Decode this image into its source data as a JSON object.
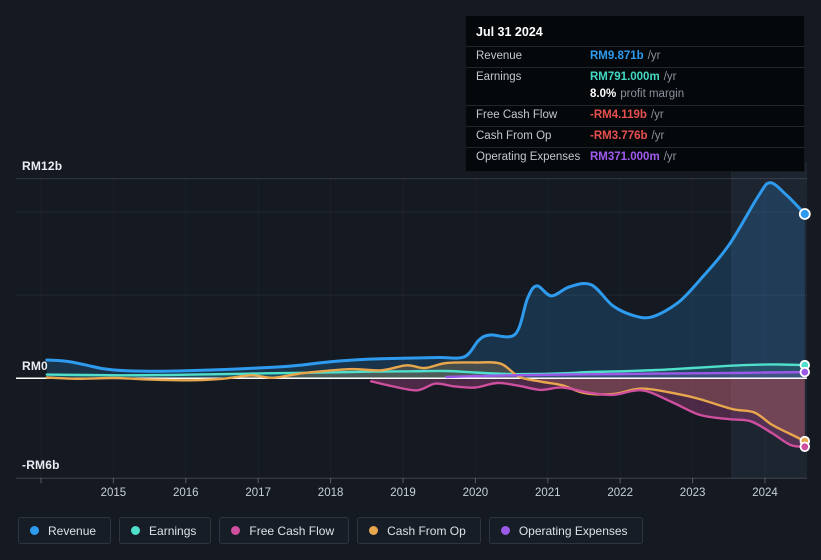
{
  "tooltip": {
    "title": "Jul 31 2024",
    "rows": [
      {
        "key": "revenue",
        "label": "Revenue",
        "value": "RM9.871b",
        "suffix": "/yr",
        "color": "#2E9BEF"
      },
      {
        "key": "earnings",
        "label": "Earnings",
        "value": "RM791.000m",
        "suffix": "/yr",
        "color": "#43D9C4"
      },
      {
        "key": "profit-margin",
        "type": "margin",
        "bold": "8.0%",
        "rest": "profit margin"
      },
      {
        "key": "free-cash-flow",
        "label": "Free Cash Flow",
        "value": "-RM4.119b",
        "suffix": "/yr",
        "color": "#E8504F"
      },
      {
        "key": "cash-from-op",
        "label": "Cash From Op",
        "value": "-RM3.776b",
        "suffix": "/yr",
        "color": "#E8504F"
      },
      {
        "key": "operating-expenses",
        "label": "Operating Expenses",
        "value": "RM371.000m",
        "suffix": "/yr",
        "color": "#A15BF0"
      }
    ]
  },
  "legend": {
    "items": [
      {
        "key": "revenue",
        "label": "Revenue",
        "color": "#2E9BEF"
      },
      {
        "key": "earnings",
        "label": "Earnings",
        "color": "#4FDFCB"
      },
      {
        "key": "free-cash-flow",
        "label": "Free Cash Flow",
        "color": "#CD4F9E"
      },
      {
        "key": "cash-from-op",
        "label": "Cash From Op",
        "color": "#E8A64D"
      },
      {
        "key": "operating-expenses",
        "label": "Operating Expenses",
        "color": "#9B59E8"
      }
    ]
  },
  "colors": {
    "background": "#151A22",
    "zero_line": "#FFFFFF",
    "axis_text": "#C9CFD6",
    "tooltip_background": "#05080B"
  },
  "chart_data": {
    "type": "line",
    "currency": "RM",
    "unit": "billions_per_year",
    "title": "",
    "xlabel": "",
    "ylabel": "RM",
    "ylim": [
      -6,
      12
    ],
    "xlim": [
      2013.65,
      2024.58
    ],
    "grid": true,
    "legend_position": "bottom",
    "ylabels": {
      "top": "RM12b",
      "zero": "RM0",
      "bottom": "-RM6b"
    },
    "gridlines_b": [
      12,
      10,
      5
    ],
    "x_ticks": [
      {
        "year": 2014,
        "label": ""
      },
      {
        "year": 2015,
        "label": "2015"
      },
      {
        "year": 2016,
        "label": "2016"
      },
      {
        "year": 2017,
        "label": "2017"
      },
      {
        "year": 2018,
        "label": "2018"
      },
      {
        "year": 2019,
        "label": "2019"
      },
      {
        "year": 2020,
        "label": "2020"
      },
      {
        "year": 2021,
        "label": "2021"
      },
      {
        "year": 2022,
        "label": "2022"
      },
      {
        "year": 2023,
        "label": "2023"
      },
      {
        "year": 2024,
        "label": "2024"
      }
    ],
    "highlight_band": {
      "from": 2023.54,
      "to": 2024.58
    },
    "series": [
      {
        "key": "revenue",
        "name": "Revenue",
        "color": "#2E9BEF",
        "fill": "rgba(46,155,239,0.20)",
        "end_value_label": "RM9.871b",
        "points": [
          [
            2014.08,
            1.1
          ],
          [
            2014.35,
            1.02
          ],
          [
            2014.6,
            0.82
          ],
          [
            2014.85,
            0.58
          ],
          [
            2015.15,
            0.46
          ],
          [
            2015.6,
            0.42
          ],
          [
            2016.0,
            0.45
          ],
          [
            2016.5,
            0.52
          ],
          [
            2017.0,
            0.62
          ],
          [
            2017.5,
            0.75
          ],
          [
            2018.0,
            1.0
          ],
          [
            2018.5,
            1.15
          ],
          [
            2019.0,
            1.2
          ],
          [
            2019.5,
            1.25
          ],
          [
            2019.85,
            1.3
          ],
          [
            2020.05,
            2.3
          ],
          [
            2020.2,
            2.6
          ],
          [
            2020.55,
            2.65
          ],
          [
            2020.72,
            4.8
          ],
          [
            2020.85,
            5.55
          ],
          [
            2021.05,
            4.95
          ],
          [
            2021.3,
            5.5
          ],
          [
            2021.6,
            5.62
          ],
          [
            2021.9,
            4.35
          ],
          [
            2022.2,
            3.75
          ],
          [
            2022.45,
            3.7
          ],
          [
            2022.8,
            4.55
          ],
          [
            2023.1,
            5.9
          ],
          [
            2023.5,
            8.0
          ],
          [
            2023.9,
            10.9
          ],
          [
            2024.07,
            11.75
          ],
          [
            2024.3,
            11.0
          ],
          [
            2024.55,
            9.871
          ]
        ]
      },
      {
        "key": "earnings",
        "name": "Earnings",
        "color": "#4FDFCB",
        "fill": "rgba(79,223,203,0.14)",
        "end_value_label": "RM791.000m",
        "points": [
          [
            2014.08,
            0.22
          ],
          [
            2014.6,
            0.2
          ],
          [
            2015.1,
            0.18
          ],
          [
            2015.6,
            0.19
          ],
          [
            2016.1,
            0.22
          ],
          [
            2016.6,
            0.26
          ],
          [
            2017.1,
            0.3
          ],
          [
            2017.6,
            0.33
          ],
          [
            2018.1,
            0.36
          ],
          [
            2018.6,
            0.4
          ],
          [
            2019.1,
            0.42
          ],
          [
            2019.6,
            0.44
          ],
          [
            2020.0,
            0.35
          ],
          [
            2020.4,
            0.27
          ],
          [
            2020.8,
            0.26
          ],
          [
            2021.2,
            0.3
          ],
          [
            2021.6,
            0.38
          ],
          [
            2022.0,
            0.42
          ],
          [
            2022.5,
            0.5
          ],
          [
            2023.0,
            0.62
          ],
          [
            2023.5,
            0.75
          ],
          [
            2023.9,
            0.82
          ],
          [
            2024.2,
            0.83
          ],
          [
            2024.55,
            0.791
          ]
        ]
      },
      {
        "key": "cash-from-op",
        "name": "Cash From Op",
        "color": "#E8A64D",
        "fill": "rgba(232,166,77,0.22)",
        "end_value_label": "-RM3.776b",
        "points": [
          [
            2014.08,
            0.05
          ],
          [
            2014.5,
            -0.03
          ],
          [
            2015.0,
            0.02
          ],
          [
            2015.5,
            -0.08
          ],
          [
            2016.05,
            -0.12
          ],
          [
            2016.5,
            -0.03
          ],
          [
            2016.9,
            0.18
          ],
          [
            2017.2,
            0.03
          ],
          [
            2017.6,
            0.3
          ],
          [
            2017.95,
            0.45
          ],
          [
            2018.3,
            0.55
          ],
          [
            2018.7,
            0.48
          ],
          [
            2019.05,
            0.78
          ],
          [
            2019.3,
            0.62
          ],
          [
            2019.6,
            0.92
          ],
          [
            2020.0,
            0.95
          ],
          [
            2020.35,
            0.88
          ],
          [
            2020.6,
            0.1
          ],
          [
            2020.9,
            -0.2
          ],
          [
            2021.2,
            -0.42
          ],
          [
            2021.5,
            -0.88
          ],
          [
            2021.9,
            -0.95
          ],
          [
            2022.3,
            -0.62
          ],
          [
            2022.8,
            -0.95
          ],
          [
            2023.1,
            -1.25
          ],
          [
            2023.55,
            -1.85
          ],
          [
            2023.85,
            -2.05
          ],
          [
            2024.1,
            -2.8
          ],
          [
            2024.35,
            -3.35
          ],
          [
            2024.55,
            -3.776
          ]
        ]
      },
      {
        "key": "free-cash-flow",
        "name": "Free Cash Flow",
        "color": "#CD4F9E",
        "fill": "rgba(205,79,158,0.30)",
        "end_value_label": "-RM4.119b",
        "points": [
          [
            2018.56,
            -0.18
          ],
          [
            2018.9,
            -0.52
          ],
          [
            2019.2,
            -0.72
          ],
          [
            2019.45,
            -0.32
          ],
          [
            2019.7,
            -0.48
          ],
          [
            2020.0,
            -0.55
          ],
          [
            2020.3,
            -0.28
          ],
          [
            2020.6,
            -0.45
          ],
          [
            2020.9,
            -0.7
          ],
          [
            2021.2,
            -0.55
          ],
          [
            2021.55,
            -0.85
          ],
          [
            2021.9,
            -1.0
          ],
          [
            2022.3,
            -0.72
          ],
          [
            2022.7,
            -1.4
          ],
          [
            2023.1,
            -2.2
          ],
          [
            2023.5,
            -2.45
          ],
          [
            2023.8,
            -2.58
          ],
          [
            2024.1,
            -3.3
          ],
          [
            2024.35,
            -4.0
          ],
          [
            2024.55,
            -4.119
          ]
        ]
      },
      {
        "key": "operating-expenses",
        "name": "Operating Expenses",
        "color": "#9B59E8",
        "fill": "rgba(155,89,232,0.22)",
        "end_value_label": "RM371.000m",
        "points": [
          [
            2019.6,
            0.08
          ],
          [
            2020.0,
            0.13
          ],
          [
            2020.5,
            0.18
          ],
          [
            2021.0,
            0.21
          ],
          [
            2021.5,
            0.24
          ],
          [
            2022.0,
            0.26
          ],
          [
            2022.5,
            0.28
          ],
          [
            2023.0,
            0.3
          ],
          [
            2023.5,
            0.32
          ],
          [
            2024.0,
            0.35
          ],
          [
            2024.55,
            0.371
          ]
        ]
      }
    ]
  }
}
